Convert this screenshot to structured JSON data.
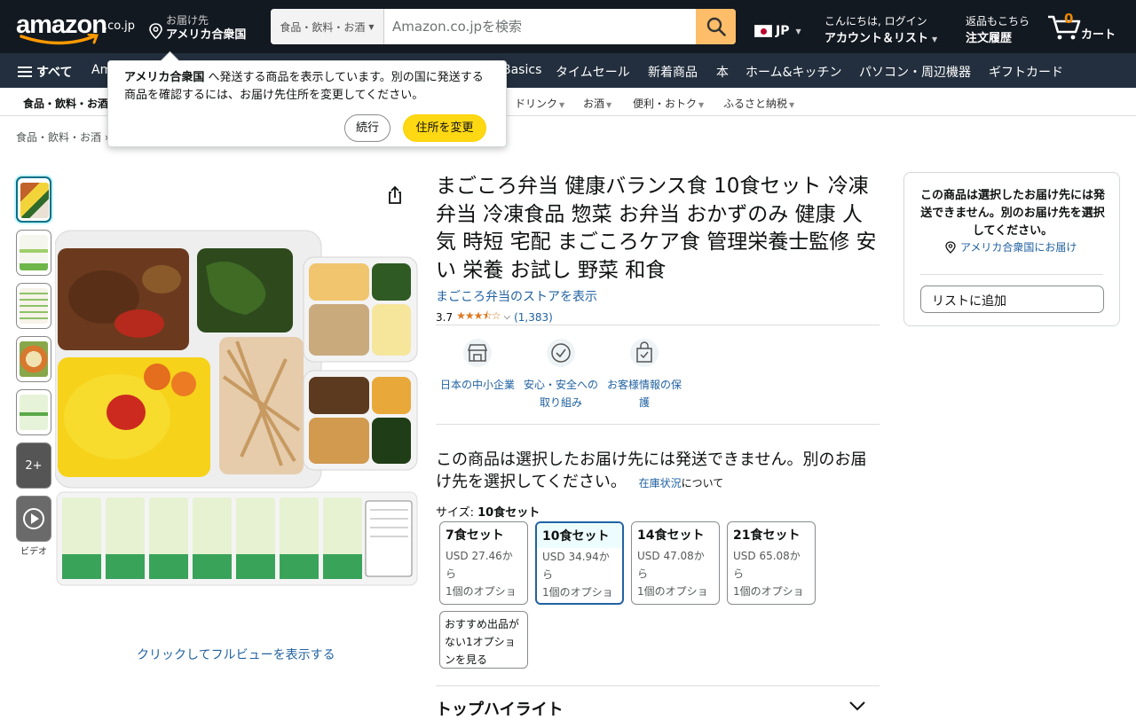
{
  "header": {
    "logo_text": "amazon",
    "logo_tld": ".co.jp",
    "deliver_line1": "お届け先",
    "deliver_line2": "アメリカ合衆国",
    "search_category": "食品・飲料・お酒",
    "search_placeholder": "Amazon.co.jpを検索",
    "lang": "JP",
    "account_line1": "こんにちは, ログイン",
    "account_line2": "アカウント＆リスト",
    "orders_line1": "返品もこちら",
    "orders_line2": "注文履歴",
    "cart_count": "0",
    "cart_label": "カート"
  },
  "main_nav": {
    "all": "すべて",
    "items": [
      "Am",
      "Basics",
      "タイムセール",
      "新着商品",
      "本",
      "ホーム&キッチン",
      "パソコン・周辺機器",
      "ギフトカード"
    ]
  },
  "sub_nav": {
    "items": [
      "食品・飲料・お酒",
      "ドリンク",
      "お酒",
      "便利・おトク",
      "ふるさと納税"
    ]
  },
  "breadcrumb": "食品・飲料・お酒 ›",
  "popover": {
    "bold": "アメリカ合衆国",
    "text": " へ発送する商品を表示しています。別の国に発送する商品を確認するには、お届け先住所を変更してください。",
    "continue": "続行",
    "change": "住所を変更"
  },
  "gallery": {
    "more_label": "2+",
    "video_label": "ビデオ",
    "full_view": "クリックしてフルビューを表示する"
  },
  "product": {
    "title": "まごころ弁当 健康バランス食 10食セット 冷凍弁当 冷凍食品 惣菜 お弁当 おかずのみ 健康 人気 時短 宅配 まごころケア食 管理栄養士監修 安い 栄養 お試し 野菜 和食",
    "store_link": "まごころ弁当のストアを表示",
    "rating": "3.7",
    "rating_stars": 3.7,
    "review_count": "(1,383)",
    "badges": [
      "日本の中小企業",
      "安心・安全への取り組み",
      "お客様情報の保護"
    ],
    "unavailable": "この商品は選択したお届け先には発送できません。別のお届け先を選択してください。",
    "stock_link": "在庫状況",
    "stock_suffix": "について",
    "size_label": "サイズ: ",
    "size_selected": "10食セット",
    "options": [
      {
        "name": "7食セット",
        "price": "USD 27.46から",
        "offer": "1個のオプション"
      },
      {
        "name": "10食セット",
        "price": "USD 34.94から",
        "offer": "1個のオプション"
      },
      {
        "name": "14食セット",
        "price": "USD 47.08から",
        "offer": "1個のオプション"
      },
      {
        "name": "21食セット",
        "price": "USD 65.08から",
        "offer": "1個のオプション"
      }
    ],
    "no_rec_option": "おすすめ出品がない1オプションを見る",
    "top_highlights": "トップハイライト"
  },
  "buybox": {
    "message": "この商品は選択したお届け先には発送できません。別のお届け先を選択してください。",
    "deliver_to": "アメリカ合衆国にお届け",
    "add_to_list": "リストに追加"
  }
}
